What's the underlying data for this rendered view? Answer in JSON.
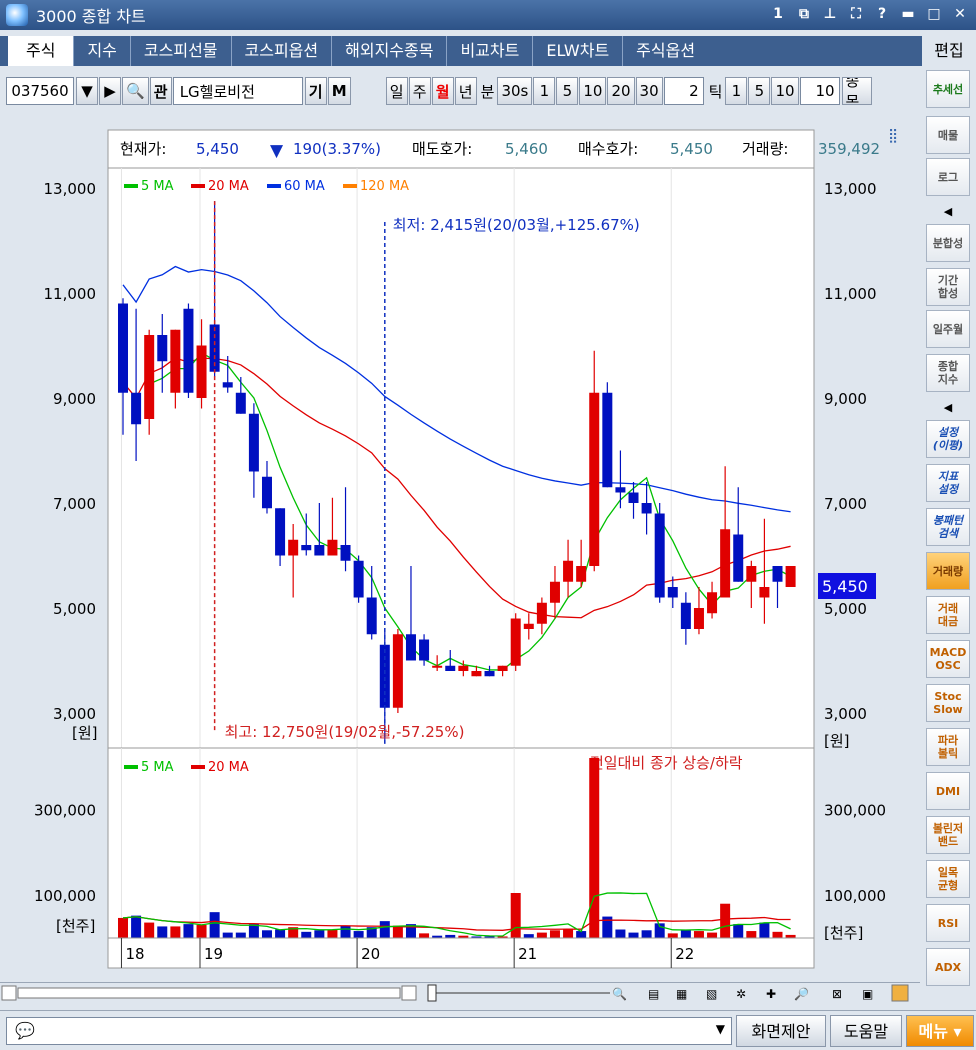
{
  "window": {
    "title": "3000 종합 차트"
  },
  "tabs": [
    "주식",
    "지수",
    "코스피선물",
    "코스피옵션",
    "해외지수종목",
    "비교차트",
    "ELW차트",
    "주식옵션"
  ],
  "edit_label": "편집",
  "toolbar": {
    "code": "037560",
    "gwan": "관",
    "name": "LG헬로비전",
    "gi": "기",
    "m": "M",
    "periods": [
      "일",
      "주",
      "월",
      "년"
    ],
    "selected_period": "월",
    "bun": "분",
    "minute_vals": [
      "30s",
      "1",
      "5",
      "10",
      "20",
      "30"
    ],
    "count": "2",
    "tick": "틱",
    "tick_vals": [
      "1",
      "5",
      "10"
    ],
    "tick_count": "10",
    "jongmok": "종목"
  },
  "quote": {
    "cur_label": "현재가:",
    "cur_value": "5,450",
    "change": "190(3.37%)",
    "ask_label": "매도호가:",
    "ask_value": "5,460",
    "bid_label": "매수호가:",
    "bid_value": "5,450",
    "vol_label": "거래량:",
    "vol_value": "359,492"
  },
  "price_chart": {
    "legend": [
      {
        "name": "5 MA",
        "color": "#00c000"
      },
      {
        "name": "20 MA",
        "color": "#e00000"
      },
      {
        "name": "60 MA",
        "color": "#0030e0"
      },
      {
        "name": "120 MA",
        "color": "#ff8000"
      }
    ],
    "y_ticks": [
      "13,000",
      "11,000",
      "9,000",
      "7,000",
      "5,000",
      "3,000"
    ],
    "unit": "[원]",
    "low_note": "최저: 2,415원(20/03월,+125.67%)",
    "high_note": "최고: 12,750원(19/02월,-57.25%)",
    "current_tag": "5,450"
  },
  "volume_chart": {
    "legend": [
      {
        "name": "5 MA",
        "color": "#00c000"
      },
      {
        "name": "20 MA",
        "color": "#e00000"
      }
    ],
    "title": "전일대비 종가 상승/하락",
    "y_ticks": [
      "300,000",
      "100,000"
    ],
    "unit": "[천주]"
  },
  "x_labels": [
    "18",
    "19",
    "20",
    "21",
    "22"
  ],
  "chart_data": {
    "type": "candlestick",
    "period": "monthly",
    "candles": [
      [
        10800,
        10900,
        8300,
        9100
      ],
      [
        9100,
        10700,
        7800,
        8500
      ],
      [
        8600,
        10300,
        8300,
        10200
      ],
      [
        10200,
        10600,
        9100,
        9700
      ],
      [
        9100,
        10300,
        8800,
        10300
      ],
      [
        10700,
        10800,
        9000,
        9100
      ],
      [
        9000,
        10500,
        8800,
        10000
      ],
      [
        10400,
        12750,
        9400,
        9500
      ],
      [
        9300,
        9800,
        9100,
        9200
      ],
      [
        9100,
        9400,
        8700,
        8700
      ],
      [
        8700,
        8900,
        7100,
        7600
      ],
      [
        7500,
        7800,
        6800,
        6900
      ],
      [
        6900,
        6900,
        5800,
        6000
      ],
      [
        6000,
        6600,
        5200,
        6300
      ],
      [
        6200,
        6800,
        6000,
        6100
      ],
      [
        6200,
        7000,
        6000,
        6000
      ],
      [
        6000,
        7100,
        6000,
        6300
      ],
      [
        6200,
        7300,
        5700,
        5900
      ],
      [
        5900,
        6000,
        5100,
        5200
      ],
      [
        5200,
        5800,
        4400,
        4500
      ],
      [
        4300,
        4600,
        2415,
        3100
      ],
      [
        3100,
        4600,
        3000,
        4500
      ],
      [
        4500,
        5800,
        4000,
        4000
      ],
      [
        4400,
        4500,
        3900,
        4000
      ],
      [
        3900,
        4100,
        3800,
        3900
      ],
      [
        3900,
        4200,
        3800,
        3800
      ],
      [
        3800,
        4000,
        3700,
        3900
      ],
      [
        3700,
        3900,
        3700,
        3800
      ],
      [
        3800,
        3900,
        3700,
        3700
      ],
      [
        3800,
        3900,
        3700,
        3900
      ],
      [
        3900,
        4900,
        3800,
        4800
      ],
      [
        4600,
        4900,
        4400,
        4700
      ],
      [
        4700,
        5200,
        4500,
        5100
      ],
      [
        5100,
        5800,
        4800,
        5500
      ],
      [
        5500,
        6300,
        5200,
        5900
      ],
      [
        5500,
        6300,
        5400,
        5800
      ],
      [
        5800,
        9900,
        5700,
        9100
      ],
      [
        9100,
        9300,
        7300,
        7300
      ],
      [
        7300,
        8000,
        6900,
        7200
      ],
      [
        7200,
        7400,
        6700,
        7000
      ],
      [
        7000,
        7400,
        6400,
        6800
      ],
      [
        6800,
        7000,
        5100,
        5200
      ],
      [
        5400,
        5600,
        5000,
        5200
      ],
      [
        5100,
        5300,
        4300,
        4600
      ],
      [
        4600,
        5400,
        4500,
        5000
      ],
      [
        4900,
        5500,
        4800,
        5300
      ],
      [
        5200,
        7700,
        5200,
        6500
      ],
      [
        6400,
        7300,
        5500,
        5500
      ],
      [
        5500,
        5900,
        5000,
        5800
      ],
      [
        5200,
        6700,
        4700,
        5400
      ],
      [
        5800,
        5800,
        5000,
        5500
      ],
      [
        5400,
        5800,
        5400,
        5800
      ]
    ],
    "x_ticks": [
      "18",
      "19",
      "20",
      "21",
      "22"
    ],
    "y_range": [
      2500,
      13500
    ],
    "volume_ylim": [
      0,
      420000
    ]
  }
}
